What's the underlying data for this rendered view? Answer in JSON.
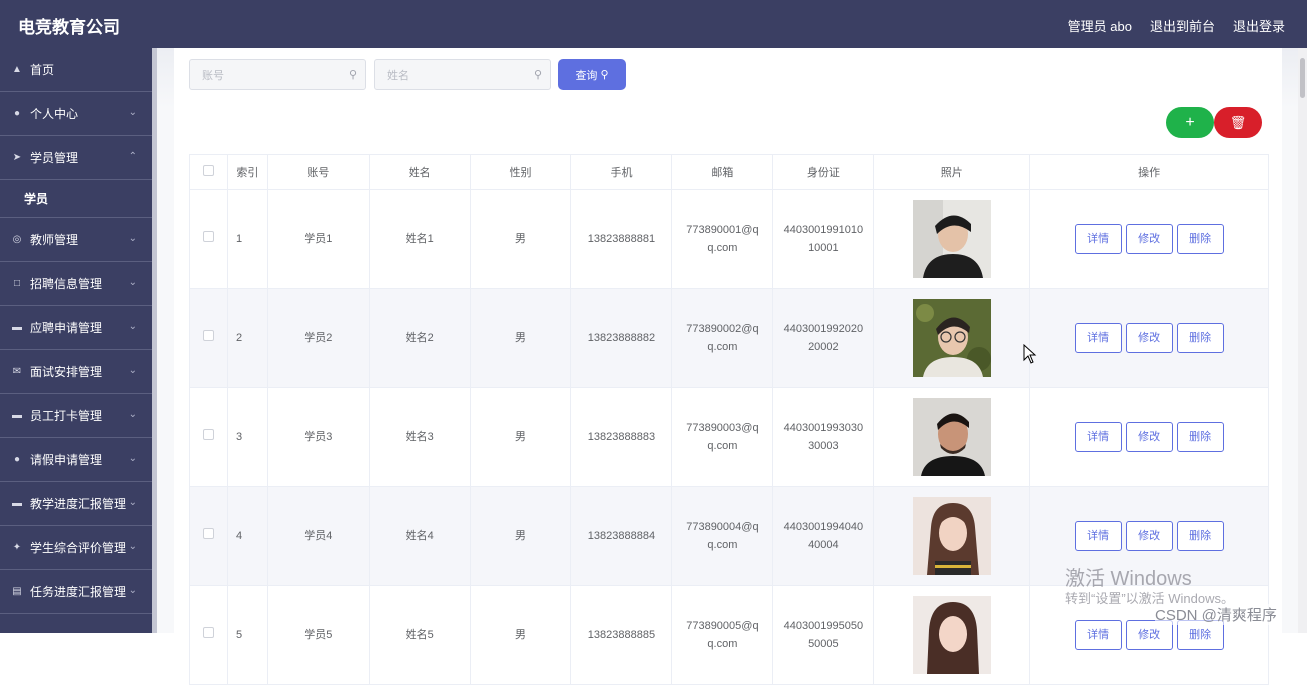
{
  "app": {
    "brand": "电竞教育公司",
    "user_label": "管理员 abo",
    "front_link": "退出到前台",
    "logout_link": "退出登录"
  },
  "sidebar": {
    "items": [
      {
        "label": "首页",
        "icon": "home-icon"
      },
      {
        "label": "个人中心",
        "icon": "user-icon"
      },
      {
        "label": "学员管理",
        "icon": "send-icon"
      },
      {
        "label": "学员",
        "sub": true
      },
      {
        "label": "教师管理",
        "icon": "globe-icon"
      },
      {
        "label": "招聘信息管理",
        "icon": "crop-icon"
      },
      {
        "label": "应聘申请管理",
        "icon": "monitor-icon"
      },
      {
        "label": "面试安排管理",
        "icon": "mail-icon"
      },
      {
        "label": "员工打卡管理",
        "icon": "monitor-icon"
      },
      {
        "label": "请假申请管理",
        "icon": "user-icon"
      },
      {
        "label": "教学进度汇报管理",
        "icon": "monitor-icon"
      },
      {
        "label": "学生综合评价管理",
        "icon": "magic-icon"
      },
      {
        "label": "任务进度汇报管理",
        "icon": "doc-icon"
      }
    ]
  },
  "search": {
    "account_placeholder": "账号",
    "name_placeholder": "姓名",
    "query_label": "查询"
  },
  "table": {
    "headers": [
      "索引",
      "账号",
      "姓名",
      "性别",
      "手机",
      "邮箱",
      "身份证",
      "照片",
      "操作"
    ],
    "rows": [
      {
        "index": "1",
        "account": "学员1",
        "name": "姓名1",
        "gender": "男",
        "phone": "13823888881",
        "email_a": "773890001@q",
        "email_b": "q.com",
        "id_a": "4403001991010",
        "id_b": "10001"
      },
      {
        "index": "2",
        "account": "学员2",
        "name": "姓名2",
        "gender": "男",
        "phone": "13823888882",
        "email_a": "773890002@q",
        "email_b": "q.com",
        "id_a": "4403001992020",
        "id_b": "20002"
      },
      {
        "index": "3",
        "account": "学员3",
        "name": "姓名3",
        "gender": "男",
        "phone": "13823888883",
        "email_a": "773890003@q",
        "email_b": "q.com",
        "id_a": "4403001993030",
        "id_b": "30003"
      },
      {
        "index": "4",
        "account": "学员4",
        "name": "姓名4",
        "gender": "男",
        "phone": "13823888884",
        "email_a": "773890004@q",
        "email_b": "q.com",
        "id_a": "4403001994040",
        "id_b": "40004"
      },
      {
        "index": "5",
        "account": "学员5",
        "name": "姓名5",
        "gender": "男",
        "phone": "13823888885",
        "email_a": "773890005@q",
        "email_b": "q.com",
        "id_a": "4403001995050",
        "id_b": "50005"
      }
    ],
    "actions": {
      "detail": "详情",
      "edit": "修改",
      "delete": "删除"
    }
  },
  "overlay": {
    "activate_title": "激活 Windows",
    "activate_sub": "转到“设置”以激活 Windows。",
    "csdn": "CSDN @清爽程序"
  }
}
